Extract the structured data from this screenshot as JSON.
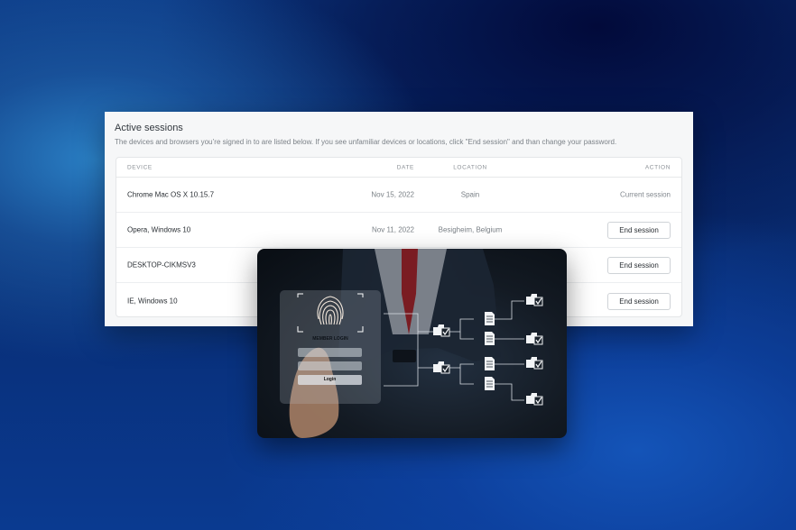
{
  "sessions": {
    "title": "Active sessions",
    "description": "The devices and browsers you’re signed in to are listed below. If you see unfamiliar devices or locations, click \"End session\" and than change your password.",
    "columns": {
      "device": "DEVICE",
      "date": "DATE",
      "location": "LOCATION",
      "action": "ACTION"
    },
    "rows": [
      {
        "device": "Chrome Mac OS X 10.15.7",
        "date": "Nov 15, 2022",
        "location": "Spain",
        "action": "Current session"
      },
      {
        "device": "Opera, Windows 10",
        "date": "Nov 11, 2022",
        "location": "Besigheim, Belgium",
        "action": "End session"
      },
      {
        "device": "DESKTOP-CIKMSV3",
        "date": "",
        "location": "",
        "action": "End session"
      },
      {
        "device": "IE, Windows 10",
        "date": "",
        "location": "",
        "action": "End session"
      }
    ]
  },
  "illustration": {
    "panel_title": "MEMBER LOGIN",
    "login_button": "Login",
    "icons": [
      "fingerprint-icon",
      "folder-check-icon",
      "document-icon"
    ]
  },
  "colors": {
    "background_blue": "#0c3a86",
    "card_background": "#f6f7f8",
    "illustration_dark": "#131a23"
  }
}
